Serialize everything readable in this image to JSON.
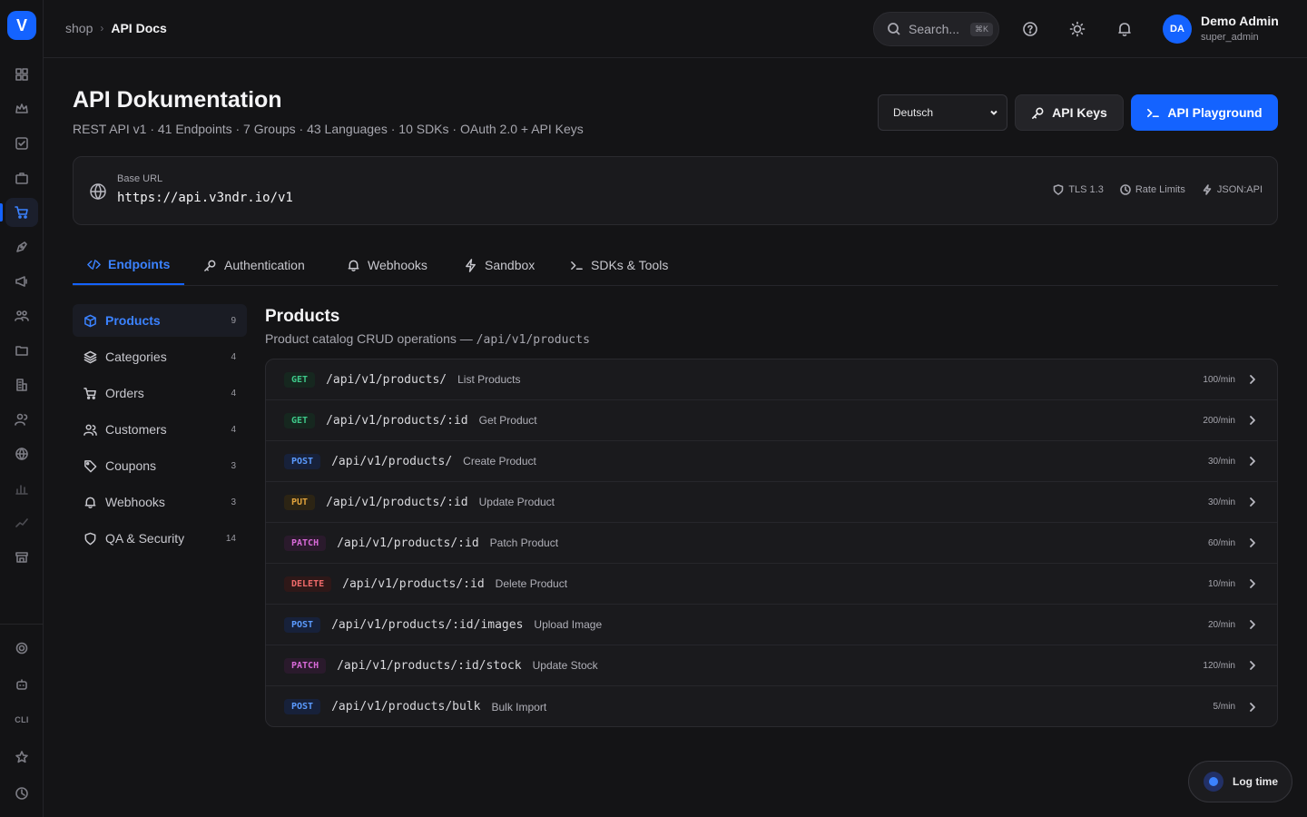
{
  "app": {
    "logo_letter": "V",
    "accent": "#1463ff"
  },
  "rail": {
    "items": [
      "dashboard-icon",
      "crown-icon",
      "check-square-icon",
      "briefcase-icon",
      "cart-icon",
      "pen-tool-icon",
      "megaphone-icon",
      "team-icon",
      "folder-icon",
      "building-icon",
      "users-icon",
      "globe-icon",
      "bar-chart-icon",
      "trend-icon",
      "store-icon"
    ],
    "active": "cart-icon",
    "bottom_items": [
      "settings-icon",
      "robot-icon",
      "cli-label",
      "star-icon",
      "clock-icon"
    ],
    "cli_label": "CLI"
  },
  "topbar": {
    "breadcrumb": [
      "shop",
      "API Docs"
    ],
    "search_placeholder": "Search...",
    "search_shortcut": "⌘K",
    "user": {
      "initials": "DA",
      "name": "Demo Admin",
      "role": "super_admin"
    }
  },
  "header": {
    "title": "API Dokumentation",
    "subtitle": "REST API v1 · 41 Endpoints · 7 Groups · 43 Languages · 10 SDKs · OAuth 2.0 + API Keys",
    "language_selected": "Deutsch",
    "api_keys_label": "API Keys",
    "playground_label": "API Playground"
  },
  "base": {
    "label": "Base URL",
    "url": "https://api.v3ndr.io/v1",
    "meta": [
      "TLS 1.3",
      "Rate Limits",
      "JSON:API"
    ]
  },
  "tabs": [
    {
      "label": "Endpoints",
      "icon": "code-icon",
      "active": true
    },
    {
      "label": "Authentication",
      "icon": "key-icon",
      "active": false
    },
    {
      "label": "Webhooks",
      "icon": "bell-icon",
      "active": false
    },
    {
      "label": "Sandbox",
      "icon": "zap-icon",
      "active": false
    },
    {
      "label": "SDKs & Tools",
      "icon": "terminal-icon",
      "active": false
    }
  ],
  "groups": [
    {
      "label": "Products",
      "count": "9",
      "icon": "box-icon",
      "active": true
    },
    {
      "label": "Categories",
      "count": "4",
      "icon": "layers-icon",
      "active": false
    },
    {
      "label": "Orders",
      "count": "4",
      "icon": "cart-icon",
      "active": false
    },
    {
      "label": "Customers",
      "count": "4",
      "icon": "users-icon",
      "active": false
    },
    {
      "label": "Coupons",
      "count": "3",
      "icon": "tag-icon",
      "active": false
    },
    {
      "label": "Webhooks",
      "count": "3",
      "icon": "bell-icon",
      "active": false
    },
    {
      "label": "QA & Security",
      "count": "14",
      "icon": "shield-icon",
      "active": false
    }
  ],
  "section": {
    "title": "Products",
    "subtitle_prefix": "Product catalog CRUD operations — ",
    "subtitle_path": "/api/v1/products"
  },
  "endpoints": [
    {
      "method": "GET",
      "path": "/api/v1/products/",
      "name": "List Products",
      "rate": "100/min"
    },
    {
      "method": "GET",
      "path": "/api/v1/products/:id",
      "name": "Get Product",
      "rate": "200/min"
    },
    {
      "method": "POST",
      "path": "/api/v1/products/",
      "name": "Create Product",
      "rate": "30/min"
    },
    {
      "method": "PUT",
      "path": "/api/v1/products/:id",
      "name": "Update Product",
      "rate": "30/min"
    },
    {
      "method": "PATCH",
      "path": "/api/v1/products/:id",
      "name": "Patch Product",
      "rate": "60/min"
    },
    {
      "method": "DELETE",
      "path": "/api/v1/products/:id",
      "name": "Delete Product",
      "rate": "10/min"
    },
    {
      "method": "POST",
      "path": "/api/v1/products/:id/images",
      "name": "Upload Image",
      "rate": "20/min"
    },
    {
      "method": "PATCH",
      "path": "/api/v1/products/:id/stock",
      "name": "Update Stock",
      "rate": "120/min"
    },
    {
      "method": "POST",
      "path": "/api/v1/products/bulk",
      "name": "Bulk Import",
      "rate": "5/min"
    }
  ],
  "log_time_label": "Log time"
}
